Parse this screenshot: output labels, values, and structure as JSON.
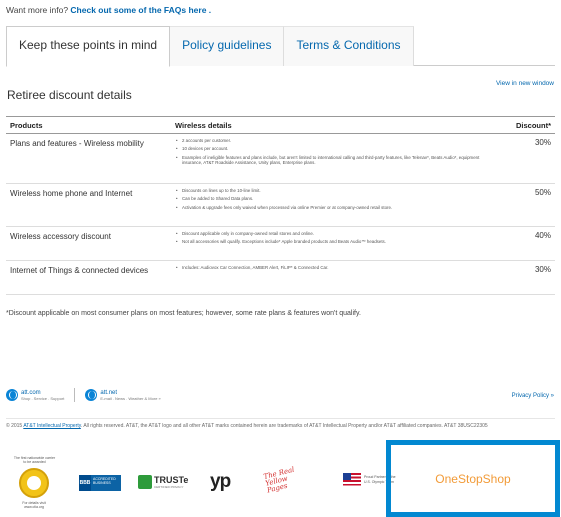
{
  "faq": {
    "prefix": "Want more info? ",
    "link": "Check out some of the FAQs here ."
  },
  "tabs": [
    {
      "label": "Keep these points in mind",
      "active": true
    },
    {
      "label": "Policy guidelines",
      "active": false
    },
    {
      "label": "Terms & Conditions",
      "active": false
    }
  ],
  "view_link": "View in new window",
  "section_title": "Retiree discount details",
  "table": {
    "headers": [
      "Products",
      "Wireless details",
      "Discount*"
    ],
    "rows": [
      {
        "product": "Plans and features - Wireless mobility",
        "details": [
          "2 accounts per customer.",
          "10 devices per account.",
          "Examples of ineligible features and plans include, but aren't limited to international calling and third-party features, like Telenav*, Beats Audio*, equipment insurance, AT&T Roadside Assistance, Unity plans, Enterprise plans."
        ],
        "discount": "30%"
      },
      {
        "product": "Wireless home phone and Internet",
        "details": [
          "Discounts on lines up to the 10-line limit.",
          "Can be added to Shared Data plans.",
          "Activation & upgrade fees only waived when processed via online Premier or at company-owned retail store."
        ],
        "discount": "50%"
      },
      {
        "product": "Wireless accessory discount",
        "details": [
          "Discount applicable only in company-owned retail stores and online.",
          "Not all accessories will qualify. Exceptions include* Apple branded products and Beats Audio™ headsets."
        ],
        "discount": "40%"
      },
      {
        "product": "Internet of Things & connected devices",
        "details": [
          "Includes: Audiovox Car Connection, AMBER Alert, FiLIP* & Connected Car."
        ],
        "discount": "30%"
      }
    ]
  },
  "footnote": "*Discount applicable on most consumer plans on most features; however, some rate plans & features won't qualify.",
  "footer": {
    "link1_name": "att.com",
    "link1_sub": "Shop . Service . Support",
    "link2_name": "att.net",
    "link2_sub": "E-mail . News . Weather & More »",
    "privacy": "Privacy Policy »",
    "copyright_prefix": "© 2015 ",
    "copyright_link": "AT&T Intellectual Property",
    "copyright_rest": ". All rights reserved. AT&T, the AT&T logo and all other AT&T marks contained herein are trademarks of AT&T Intellectual Property and/or AT&T affiliated companies. AT&T 38USC22305"
  },
  "logos": {
    "seal_top": "The first nationwide carrier to be awarded",
    "seal_bottom": "For details visit www.ctia.org",
    "bbb_mark": "BBB",
    "bbb_text": "ACCREDITED BUSINESS",
    "truste_name": "TRUSTe",
    "truste_sub": "CERTIFIED PRIVACY",
    "yp": "yp",
    "real_yellow": "The Real Yellow Pages",
    "usoly_text": "Proud Partner of the U.S. Olympic Team"
  },
  "oss": {
    "label": "OneStopShop",
    "border_color": "#0288d1",
    "text_color": "#f29b38"
  }
}
